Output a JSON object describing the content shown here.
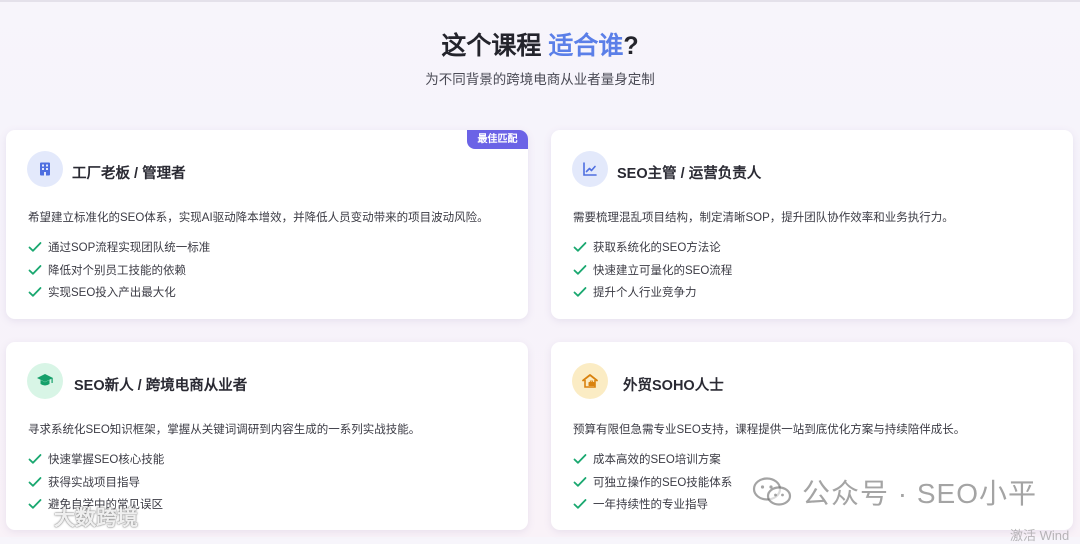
{
  "header": {
    "title_main": "这个课程",
    "title_accent": "适合谁",
    "title_suffix": "?",
    "subtitle": "为不同背景的跨境电商从业者量身定制"
  },
  "colors": {
    "accent": "#5b7fe8",
    "badge": "#6b63e6",
    "check": "#1aa870"
  },
  "cards": [
    {
      "icon": "building-icon",
      "title": "工厂老板 / 管理者",
      "badge": "最佳匹配",
      "description": "希望建立标准化的SEO体系，实现AI驱动降本增效，并降低人员变动带来的项目波动风险。",
      "features": [
        "通过SOP流程实现团队统一标准",
        "降低对个别员工技能的依赖",
        "实现SEO投入产出最大化"
      ]
    },
    {
      "icon": "chart-line-icon",
      "title": "SEO主管 / 运营负责人",
      "description": "需要梳理混乱项目结构，制定清晰SOP，提升团队协作效率和业务执行力。",
      "features": [
        "获取系统化的SEO方法论",
        "快速建立可量化的SEO流程",
        "提升个人行业竞争力"
      ]
    },
    {
      "icon": "graduate-icon",
      "title": "SEO新人 / 跨境电商从业者",
      "description": "寻求系统化SEO知识框架，掌握从关键词调研到内容生成的一系列实战技能。",
      "features": [
        "快速掌握SEO核心技能",
        "获得实战项目指导",
        "避免自学中的常见误区"
      ]
    },
    {
      "icon": "home-office-icon",
      "title": "外贸SOHO人士",
      "description": "预算有限但急需专业SEO支持，课程提供一站到底优化方案与持续陪伴成长。",
      "features": [
        "成本高效的SEO培训方案",
        "可独立操作的SEO技能体系",
        "一年持续性的专业指导"
      ]
    }
  ],
  "watermarks": {
    "wechat": "公众号 · SEO小平",
    "left_brand": "大数跨境",
    "activate": "激活 Wind"
  }
}
